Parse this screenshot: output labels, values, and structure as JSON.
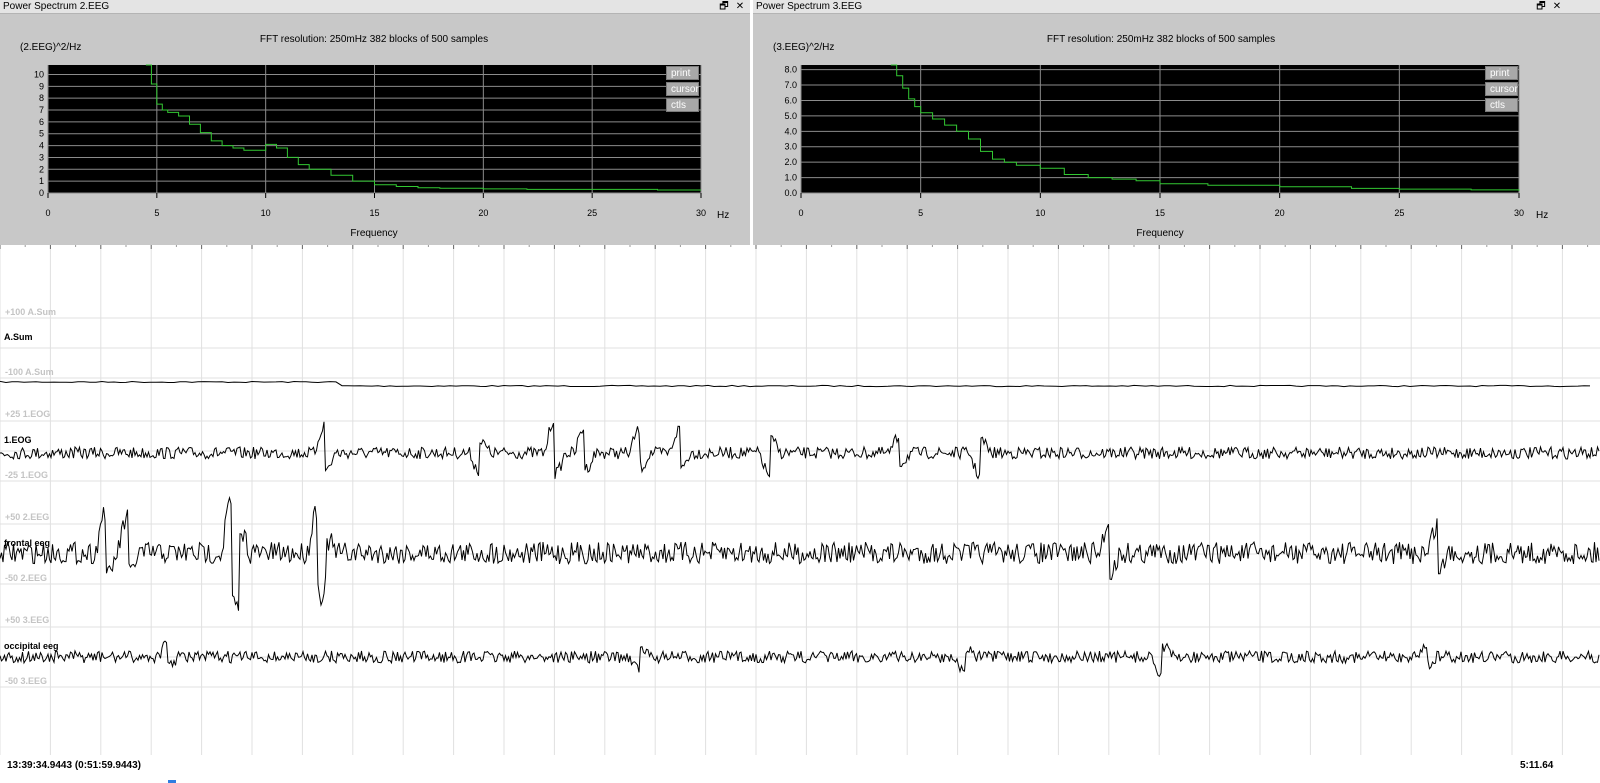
{
  "panels": [
    {
      "title": "Power Spectrum 2.EEG",
      "subtitle": "FFT resolution: 250mHz   382 blocks of 500 samples",
      "ylabel": "(2.EEG)^2/Hz",
      "xlabel": "Frequency",
      "xunit": "Hz",
      "restore_glyph": "🗗",
      "close_glyph": "✕",
      "buttons": [
        "print",
        "cursor",
        "ctls"
      ]
    },
    {
      "title": "Power Spectrum 3.EEG",
      "subtitle": "FFT resolution: 250mHz   382 blocks of 500 samples",
      "ylabel": "(3.EEG)^2/Hz",
      "xlabel": "Frequency",
      "xunit": "Hz",
      "restore_glyph": "🗗",
      "close_glyph": "✕",
      "buttons": [
        "print",
        "cursor",
        "ctls"
      ]
    }
  ],
  "channels": [
    {
      "name": "A.Sum",
      "top_label": "+100 A.Sum",
      "bottom_label": "-100 A.Sum"
    },
    {
      "name": "1.EOG",
      "top_label": "+25 1.EOG",
      "bottom_label": "-25 1.EOG"
    },
    {
      "name": "frontal eeg",
      "top_label": "+50 2.EEG",
      "bottom_label": "-50 2.EEG"
    },
    {
      "name": "occipital eeg",
      "top_label": "+50 3.EEG",
      "bottom_label": "-50 3.EEG"
    }
  ],
  "status": {
    "time_left": "13:39:34.9443 (0:51:59.9443)",
    "time_right": "5:11.64"
  },
  "colors": {
    "plot_bg": "#000000",
    "spectrum_line": "#32c832",
    "grid": "#8c8c8c",
    "panel_bg": "#c8c8c8",
    "trace": "#000000",
    "trace_grid": "#e0e0e0",
    "scale_label": "#c4c4c4"
  },
  "chart_data": [
    {
      "type": "line",
      "title": "FFT resolution: 250mHz   382 blocks of 500 samples",
      "xlabel": "Frequency",
      "ylabel": "(2.EEG)^2/Hz",
      "xlim": [
        0,
        30
      ],
      "ylim": [
        0,
        10.8
      ],
      "xticks": [
        0,
        5,
        10,
        15,
        20,
        25,
        30
      ],
      "yticks": [
        0,
        1,
        2,
        3,
        4,
        5,
        6,
        7,
        8,
        9,
        10
      ],
      "ytick_labels": [
        "0",
        "1",
        "2",
        "3",
        "4",
        "5",
        "6",
        "7",
        "8",
        "9",
        "10"
      ],
      "grid": true,
      "series": [
        {
          "x": [
            4.5,
            4.75,
            5,
            5.25,
            5.5,
            6,
            6.5,
            7,
            7.5,
            8,
            8.5,
            9,
            9.5,
            10,
            10.5,
            11,
            11.5,
            12,
            13,
            14,
            15,
            16,
            17,
            18,
            20,
            22,
            25,
            28,
            30
          ],
          "values": [
            10.8,
            9.2,
            7.5,
            7.0,
            6.8,
            6.5,
            5.8,
            5.1,
            4.4,
            4.0,
            3.8,
            3.6,
            3.6,
            4.1,
            3.8,
            3.0,
            2.4,
            2.0,
            1.5,
            1.0,
            0.7,
            0.55,
            0.45,
            0.4,
            0.35,
            0.3,
            0.3,
            0.25,
            0.25
          ]
        }
      ]
    },
    {
      "type": "line",
      "title": "FFT resolution: 250mHz   382 blocks of 500 samples",
      "xlabel": "Frequency",
      "ylabel": "(3.EEG)^2/Hz",
      "xlim": [
        0,
        30
      ],
      "ylim": [
        0,
        8.3
      ],
      "xticks": [
        0,
        5,
        10,
        15,
        20,
        25,
        30
      ],
      "yticks": [
        0,
        1,
        2,
        3,
        4,
        5,
        6,
        7,
        8
      ],
      "ytick_labels": [
        "0.0",
        "1.0",
        "2.0",
        "3.0",
        "4.0",
        "5.0",
        "6.0",
        "7.0",
        "8.0"
      ],
      "grid": true,
      "series": [
        {
          "x": [
            3.75,
            4,
            4.25,
            4.5,
            4.75,
            5,
            5.5,
            6,
            6.5,
            7,
            7.5,
            8,
            8.5,
            9,
            10,
            11,
            12,
            13,
            14,
            15,
            17,
            20,
            23,
            25,
            28,
            30
          ],
          "values": [
            8.3,
            7.6,
            6.8,
            6.1,
            5.6,
            5.2,
            4.8,
            4.4,
            4.0,
            3.5,
            2.7,
            2.2,
            2.0,
            1.8,
            1.6,
            1.2,
            1.0,
            0.9,
            0.8,
            0.6,
            0.5,
            0.4,
            0.3,
            0.25,
            0.2,
            0.15
          ]
        }
      ]
    }
  ]
}
